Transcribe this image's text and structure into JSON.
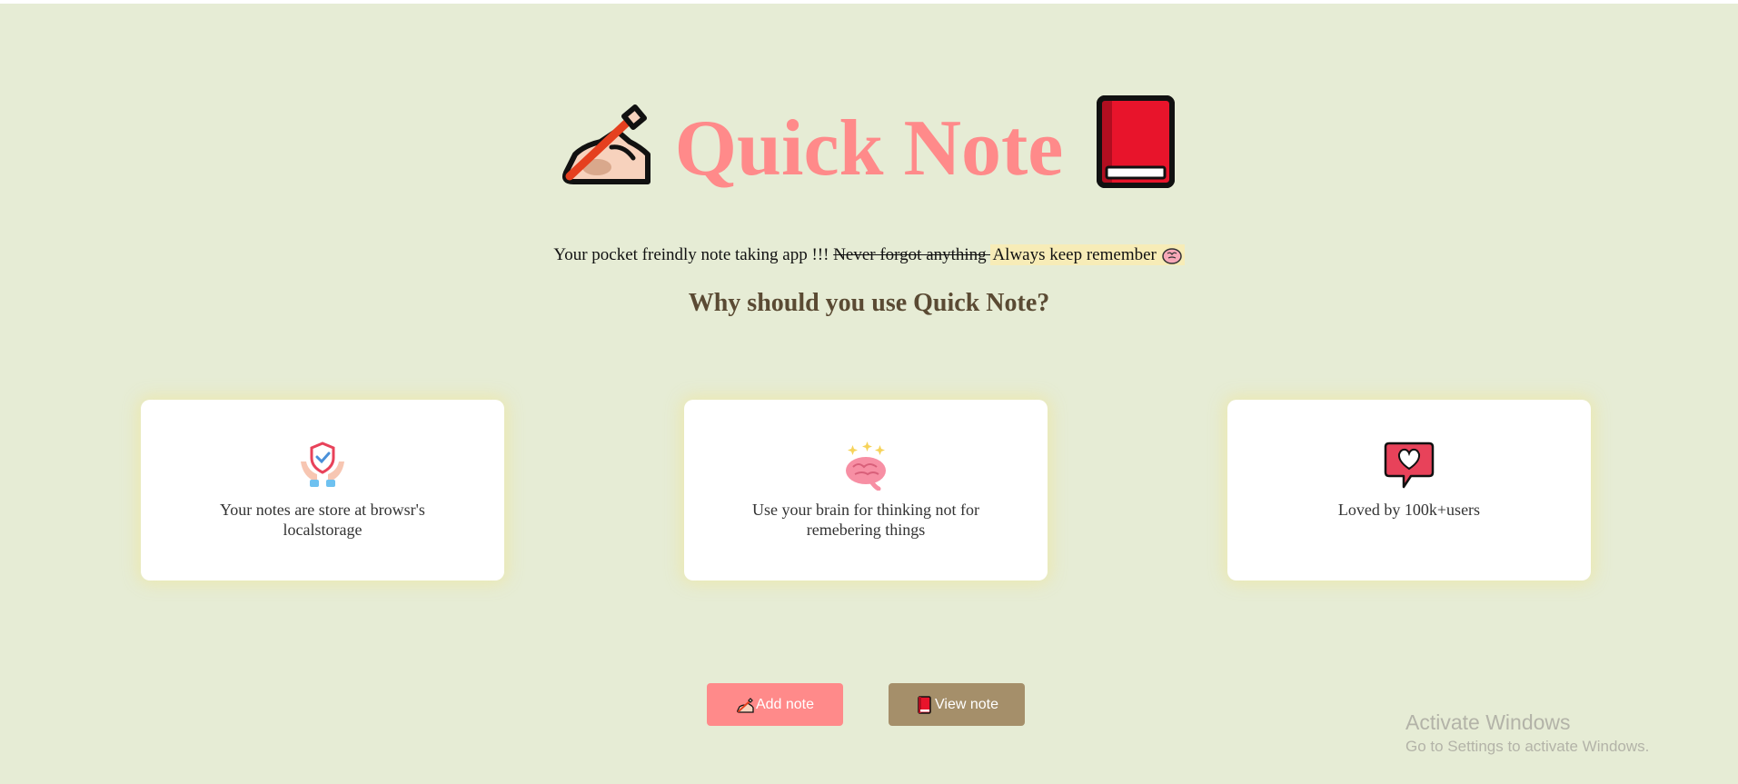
{
  "hero": {
    "title": "Quick Note",
    "left_icon": "writing-hand-icon",
    "right_icon": "red-book-icon"
  },
  "tagline": {
    "text": "Your pocket freindly note taking app !!! ",
    "struck": "Never forgot anything ",
    "highlighted": "Always keep remember ",
    "icon": "brain-icon"
  },
  "section": {
    "heading": "Why should you use Quick Note?"
  },
  "features": [
    {
      "icon": "shield-hands-icon",
      "text": "Your notes are store at browsr's localstorage"
    },
    {
      "icon": "brain-sparkle-icon",
      "text": "Use your brain for thinking not for remebering things"
    },
    {
      "icon": "heart-speech-bubble-icon",
      "text": "Loved by 100k+users"
    }
  ],
  "buttons": {
    "add": {
      "label": "Add note",
      "icon": "writing-hand-icon",
      "color": "#ff8a8a"
    },
    "view": {
      "label": "View note",
      "icon": "red-book-icon",
      "color": "#a58f6a"
    }
  },
  "watermark": {
    "title": "Activate Windows",
    "subtitle": "Go to Settings to activate Windows."
  },
  "colors": {
    "background": "#e6ecd5",
    "title": "#ff8a8a",
    "heading": "#5a4a33",
    "highlight": "#f7ecb7"
  }
}
